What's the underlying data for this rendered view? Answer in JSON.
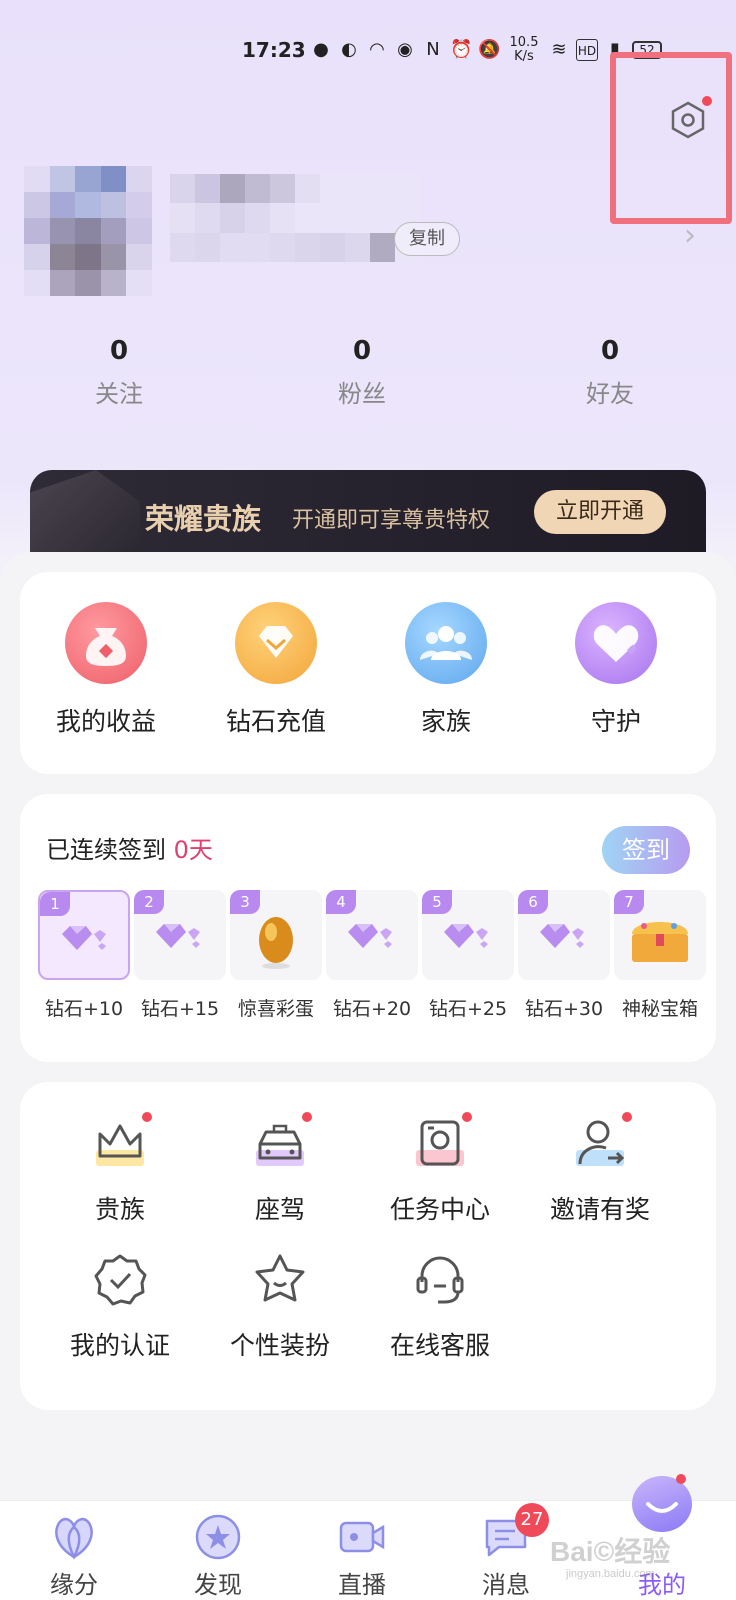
{
  "status_bar": {
    "time": "17:23",
    "speed": "10.5\nK/s",
    "icons": [
      "wechat-icon",
      "app-icon",
      "app2-icon",
      "eye-icon",
      "nfc-icon",
      "alarm-icon",
      "mute-icon",
      "wifi-icon",
      "hd-icon",
      "signal-icon",
      "battery-icon"
    ]
  },
  "profile": {
    "copy_label": "复制"
  },
  "stats": [
    {
      "value": "0",
      "label": "关注"
    },
    {
      "value": "0",
      "label": "粉丝"
    },
    {
      "value": "0",
      "label": "好友"
    }
  ],
  "vip": {
    "title": "荣耀贵族",
    "desc": "开通即可享尊贵特权",
    "button": "立即开通"
  },
  "quick_actions": [
    {
      "label": "我的收益",
      "icon": "money-bag-icon",
      "color": "#f26b73"
    },
    {
      "label": "钻石充值",
      "icon": "diamond-icon",
      "color": "#f3b23e"
    },
    {
      "label": "家族",
      "icon": "family-icon",
      "color": "#6fb4f2"
    },
    {
      "label": "守护",
      "icon": "heart-icon",
      "color": "#b98af0"
    }
  ],
  "sign_in": {
    "title_prefix": "已连续签到 ",
    "days": "0天",
    "button": "签到",
    "rewards": [
      {
        "num": "1",
        "label": "钻石+10"
      },
      {
        "num": "2",
        "label": "钻石+15"
      },
      {
        "num": "3",
        "label": "惊喜彩蛋"
      },
      {
        "num": "4",
        "label": "钻石+20"
      },
      {
        "num": "5",
        "label": "钻石+25"
      },
      {
        "num": "6",
        "label": "钻石+30"
      },
      {
        "num": "7",
        "label": "神秘宝箱"
      }
    ]
  },
  "features": [
    {
      "label": "贵族",
      "icon": "crown-icon"
    },
    {
      "label": "座驾",
      "icon": "car-icon"
    },
    {
      "label": "任务中心",
      "icon": "task-icon"
    },
    {
      "label": "邀请有奖",
      "icon": "invite-icon"
    },
    {
      "label": "我的认证",
      "icon": "verified-icon"
    },
    {
      "label": "个性装扮",
      "icon": "star-face-icon"
    },
    {
      "label": "在线客服",
      "icon": "headset-icon"
    }
  ],
  "tabs": [
    {
      "label": "缘分",
      "icon": "fate-icon"
    },
    {
      "label": "发现",
      "icon": "discover-icon"
    },
    {
      "label": "直播",
      "icon": "live-icon"
    },
    {
      "label": "消息",
      "icon": "message-icon",
      "badge": "27"
    },
    {
      "label": "我的",
      "icon": "me-icon"
    }
  ],
  "colors": {
    "accent": "#8b5cf6",
    "highlight_red": "#f04a5a",
    "annotation_box": "#f1707e"
  }
}
